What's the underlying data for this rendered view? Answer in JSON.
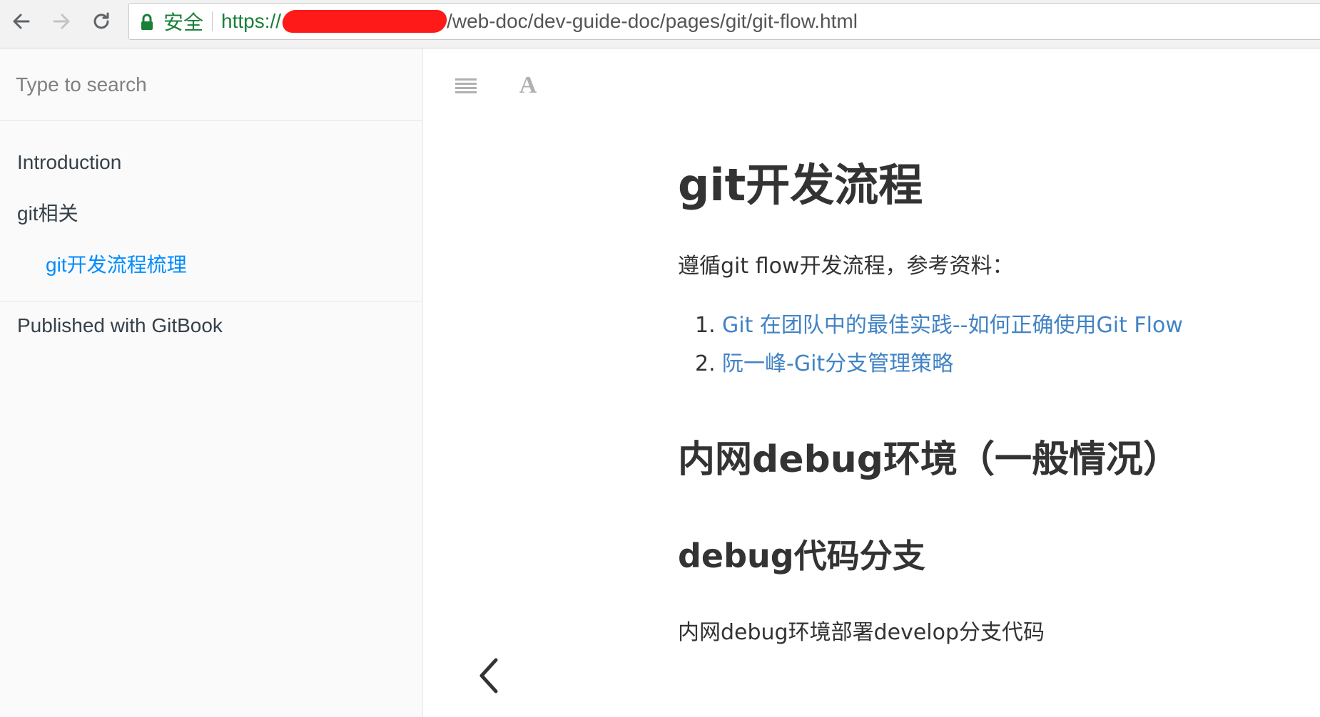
{
  "browser": {
    "secure_label": "安全",
    "url_scheme": "https://",
    "url_path": "/web-doc/dev-guide-doc/pages/git/git-flow.html"
  },
  "sidebar": {
    "search_placeholder": "Type to search",
    "items": [
      {
        "label": "Introduction"
      },
      {
        "label": "git相关"
      },
      {
        "label": "git开发流程梳理",
        "active": true
      }
    ],
    "footer": "Published with GitBook"
  },
  "toolbar": {
    "font_icon_glyph": "A"
  },
  "article": {
    "title": "git开发流程",
    "intro": "遵循git flow开发流程，参考资料：",
    "references": [
      {
        "num": "1.",
        "text": "Git 在团队中的最佳实践--如何正确使用Git Flow"
      },
      {
        "num": "2.",
        "text": "阮一峰-Git分支管理策略"
      }
    ],
    "section_heading": "内网debug环境（一般情况）",
    "subsection_heading": "debug代码分支",
    "body": "内网debug环境部署develop分支代码"
  },
  "colors": {
    "active_link": "#008cff",
    "content_link": "#4183c4",
    "secure_green": "#188038",
    "redaction": "#ff1a1a"
  }
}
